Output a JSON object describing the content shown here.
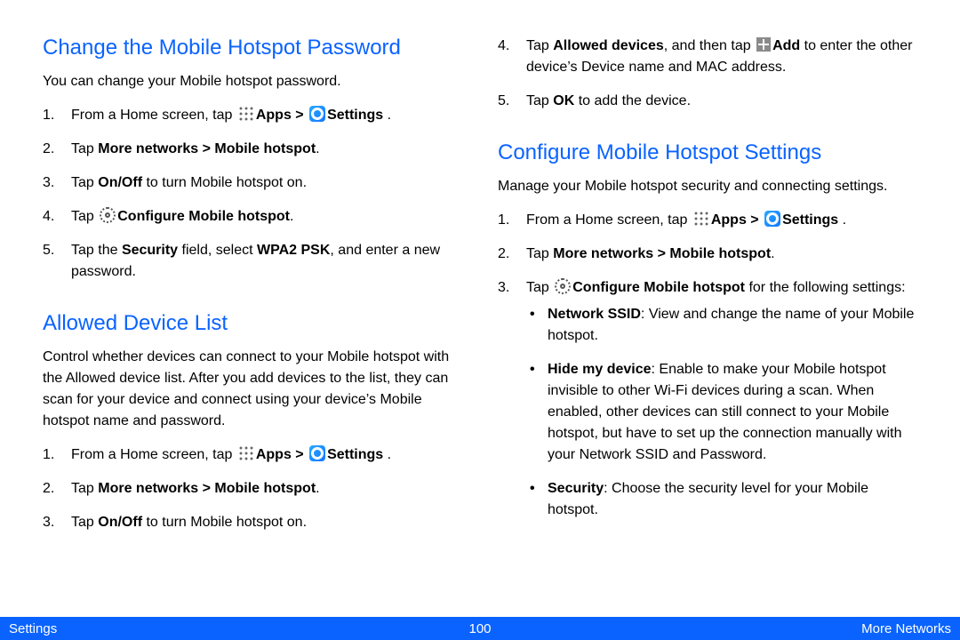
{
  "left": {
    "h1": "Change the Mobile Hotspot Password",
    "intro1": "You can change your Mobile hotspot password.",
    "s1_1a": "From a Home screen, tap ",
    "s1_1b": "Apps > ",
    "s1_1c": "Settings ",
    "s1_1d": ".",
    "s1_2a": "Tap ",
    "s1_2b": "More networks > Mobile hotspot",
    "s1_2c": ".",
    "s1_3a": "Tap ",
    "s1_3b": "On/Off",
    "s1_3c": " to turn Mobile hotspot on.",
    "s1_4a": "Tap ",
    "s1_4b": "Configure Mobile hotspot",
    "s1_4c": ".",
    "s1_5a": "Tap the ",
    "s1_5b": "Security",
    "s1_5c": " field, select ",
    "s1_5d": "WPA2 PSK",
    "s1_5e": ", and enter a new password.",
    "h2": "Allowed Device List",
    "intro2": "Control whether devices can connect to your Mobile hotspot with the Allowed device list. After you add devices to the list, they can scan for your device and connect using your device’s Mobile hotspot name and password.",
    "s2_1a": "From a Home screen, tap ",
    "s2_1b": "Apps > ",
    "s2_1c": "Settings ",
    "s2_1d": ".",
    "s2_2a": "Tap ",
    "s2_2b": "More networks > Mobile hotspot",
    "s2_2c": ".",
    "s2_3a": "Tap ",
    "s2_3b": "On/Off",
    "s2_3c": " to turn Mobile hotspot on."
  },
  "right": {
    "cont4a": "Tap ",
    "cont4b": "Allowed devices",
    "cont4c": ", and then tap ",
    "cont4d": "Add",
    "cont4e": " to enter the other device’s Device name and MAC address.",
    "cont5a": "Tap ",
    "cont5b": "OK",
    "cont5c": " to add the device.",
    "h3": "Configure Mobile Hotspot Settings",
    "intro3": "Manage your Mobile hotspot security and connecting settings.",
    "s3_1a": "From a Home screen, tap ",
    "s3_1b": "Apps > ",
    "s3_1c": "Settings ",
    "s3_1d": ".",
    "s3_2a": "Tap ",
    "s3_2b": "More networks > Mobile hotspot",
    "s3_2c": ".",
    "s3_3a": "Tap ",
    "s3_3b": "Configure Mobile hotspot",
    "s3_3c": " for the following settings:",
    "b1a": "Network SSID",
    "b1b": ": View and change the name of your Mobile hotspot.",
    "b2a": "Hide my device",
    "b2b": ": Enable to make your Mobile hotspot invisible to other Wi-Fi devices during a scan. When enabled, other devices can still connect to your Mobile hotspot, but have to set up the connection manually with your Network SSID and Password.",
    "b3a": "Security",
    "b3b": ": Choose the security level for your Mobile hotspot."
  },
  "footer": {
    "left": "Settings",
    "center": "100",
    "right": "More Networks"
  }
}
